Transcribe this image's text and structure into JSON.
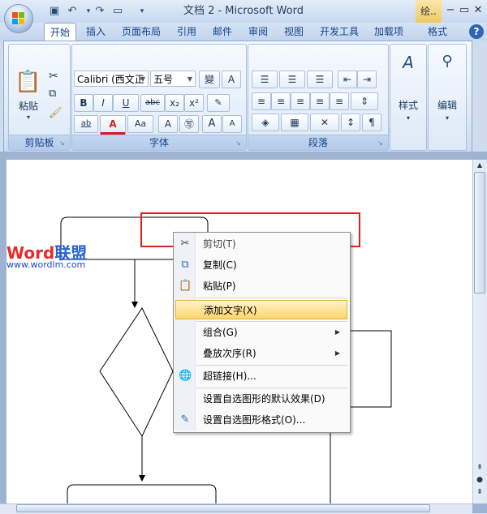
{
  "window": {
    "title": "文档 2 - Microsoft Word",
    "context_tab_title": "绘..",
    "controls": [
      "minimize-icon",
      "restore-icon",
      "close-icon"
    ]
  },
  "quick_access": [
    "save-icon",
    "undo-icon",
    "redo-icon",
    "new-icon",
    "customize-icon"
  ],
  "tabs": [
    {
      "label": "开始",
      "active": true
    },
    {
      "label": "插入"
    },
    {
      "label": "页面布局"
    },
    {
      "label": "引用"
    },
    {
      "label": "邮件"
    },
    {
      "label": "审阅"
    },
    {
      "label": "视图"
    },
    {
      "label": "开发工具"
    },
    {
      "label": "加载项"
    },
    {
      "label": "格式"
    }
  ],
  "ribbon": {
    "clipboard": {
      "label": "剪贴板",
      "paste_label": "粘贴"
    },
    "font": {
      "label": "字体",
      "font_name": "Calibri (西文正",
      "font_size": "五号",
      "bold": "B",
      "italic": "I",
      "underline": "U",
      "strike": "abc",
      "subscript": "x₂",
      "superscript": "x²",
      "highlight": "ab",
      "font_color": "A",
      "case": "Aa",
      "grow": "A",
      "shrink": "A",
      "wen": "變",
      "clear_format": "A"
    },
    "paragraph": {
      "label": "段落"
    },
    "styles": {
      "label": "样式"
    },
    "editing": {
      "label": "编辑"
    }
  },
  "watermark": {
    "brand_a": "Word",
    "brand_b": "联盟",
    "url": "www.wordlm.com",
    "color_a": "#e52b2b",
    "color_b": "#2563d6"
  },
  "context_menu": {
    "items": [
      {
        "label": "剪切(T)",
        "icon": "scissors-icon",
        "enabled": false
      },
      {
        "label": "复制(C)",
        "icon": "copy-icon"
      },
      {
        "label": "粘贴(P)",
        "icon": "paste-icon"
      },
      {
        "label": "添加文字(X)",
        "highlighted": true
      },
      {
        "label": "组合(G)",
        "submenu": true
      },
      {
        "label": "叠放次序(R)",
        "submenu": true
      },
      {
        "label": "超链接(H)...",
        "icon": "hyperlink-icon"
      },
      {
        "label": "设置自选图形的默认效果(D)"
      },
      {
        "label": "设置自选图形格式(O)...",
        "icon": "format-shape-icon"
      }
    ]
  },
  "colors": {
    "highlight_box": "#e0201f",
    "menu_highlight": "#ffd66b",
    "accent": "#15428b"
  }
}
